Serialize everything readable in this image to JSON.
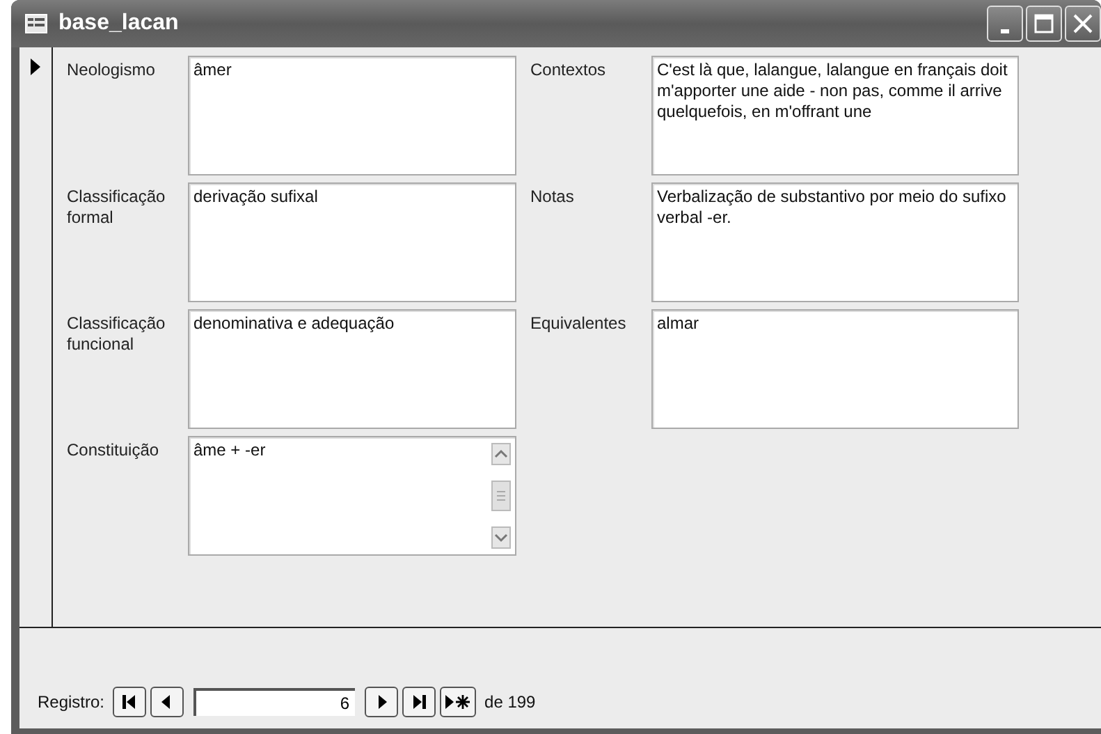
{
  "window": {
    "title": "base_lacan"
  },
  "record_selector": {
    "current": true
  },
  "left_fields": [
    {
      "label": "Neologismo",
      "value": "âmer",
      "kind": "plain"
    },
    {
      "label": "Classificação formal",
      "value": "derivação sufixal",
      "kind": "plain"
    },
    {
      "label": "Classificação funcional",
      "value": "denominativa e adequação",
      "kind": "plain"
    },
    {
      "label": "Constituição",
      "value": "âme + -er",
      "kind": "scroll"
    }
  ],
  "right_fields": [
    {
      "label": "Contextos",
      "value": "C'est là que, lalangue, lalangue en français doit m'apporter une aide - non pas, comme il arrive quelquefois, en m'offrant une"
    },
    {
      "label": "Notas",
      "value": "Verbalização de substantivo por meio do sufixo verbal -er."
    },
    {
      "label": "Equivalentes",
      "value": "almar"
    }
  ],
  "navigation": {
    "label": "Registro:",
    "record": "6",
    "total": "de 199"
  }
}
